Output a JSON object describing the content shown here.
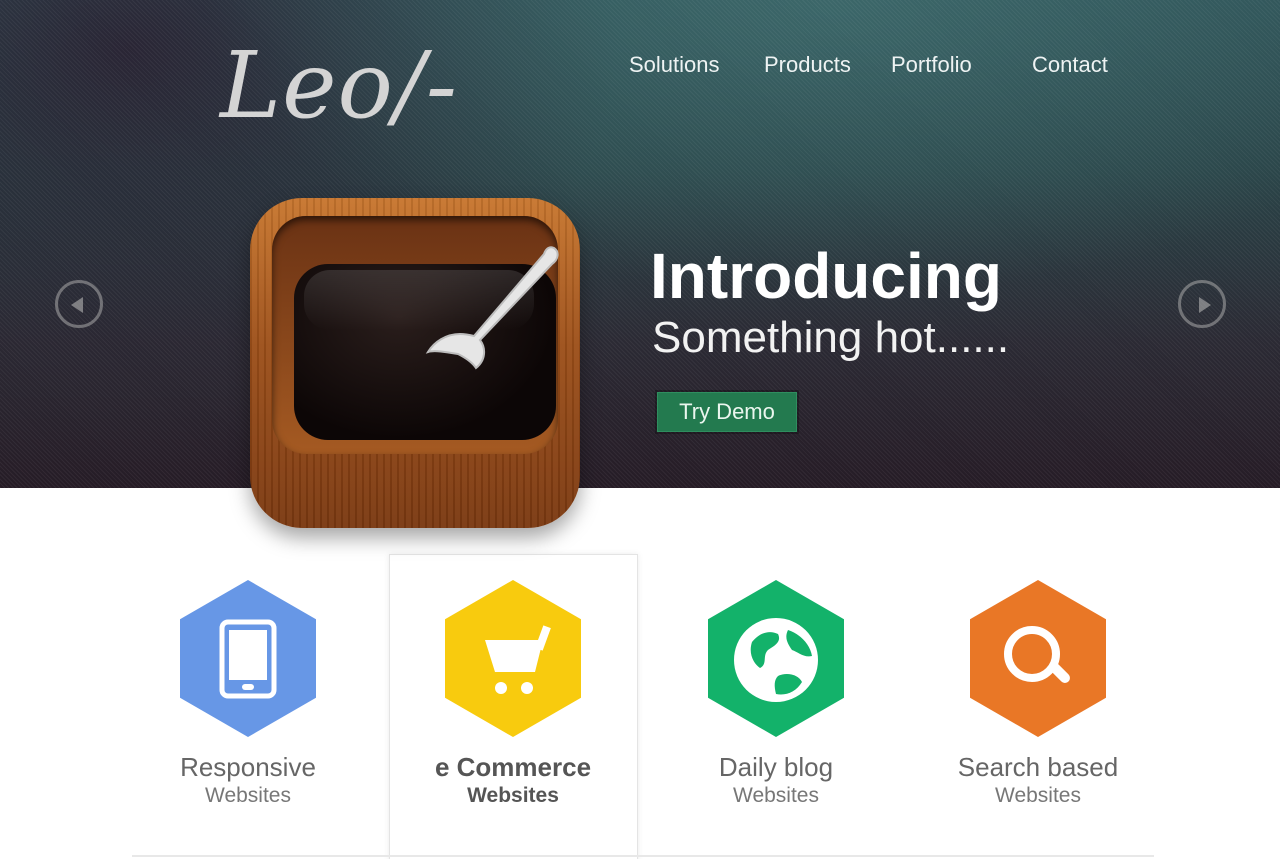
{
  "brand": {
    "logo": "Leo/-"
  },
  "nav": {
    "items": [
      {
        "label": "Solutions"
      },
      {
        "label": "Products"
      },
      {
        "label": "Portfolio"
      },
      {
        "label": "Contact"
      }
    ]
  },
  "hero": {
    "headline": "Introducing",
    "subline": "Something hot......",
    "cta_label": "Try Demo",
    "cta_color": "#237a4f",
    "prev_icon": "arrow-left-icon",
    "next_icon": "arrow-right-icon"
  },
  "features": [
    {
      "title": "Responsive",
      "subtitle": "Websites",
      "icon": "smartphone-icon",
      "color": "#6797e6",
      "active": false
    },
    {
      "title": "e Commerce",
      "subtitle": "Websites",
      "icon": "shopping-cart-icon",
      "color": "#f8cb0e",
      "active": true
    },
    {
      "title": "Daily blog",
      "subtitle": "Websites",
      "icon": "globe-icon",
      "color": "#13b26a",
      "active": false
    },
    {
      "title": "Search based",
      "subtitle": "Websites",
      "icon": "search-icon",
      "color": "#e97726",
      "active": false
    }
  ]
}
